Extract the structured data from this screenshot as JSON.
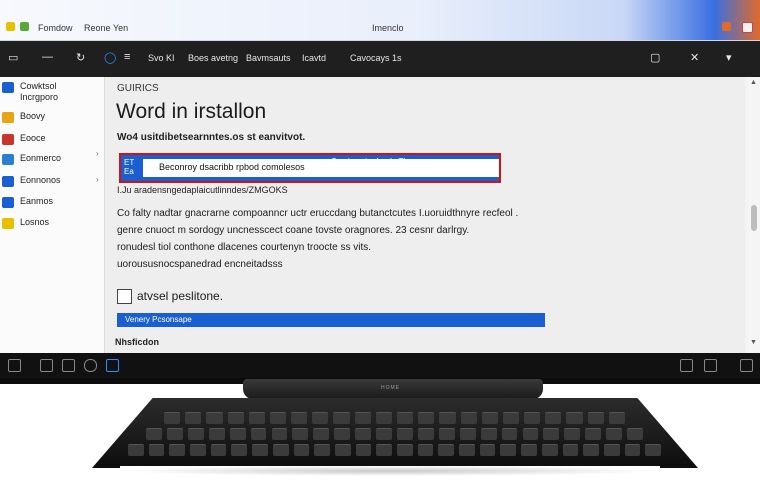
{
  "window": {
    "top_tabs": [
      "Fomdow",
      "Reone",
      "Yen"
    ],
    "title": "Imenclo",
    "accent_colors": {
      "blue": "#1a5fd1",
      "red_highlight": "#d01414",
      "orange": "#e06a2a"
    }
  },
  "toolbar": {
    "items": [
      "Svo KI",
      "Boes avetng",
      "Bavmsauts",
      "Icavtd",
      "Cavocays 1s"
    ],
    "icons": [
      "back-icon",
      "refresh-icon",
      "edge-icon",
      "window-icon",
      "close-icon",
      "chevron-icon"
    ]
  },
  "sidebar": {
    "items": [
      {
        "label": "Cowktsol",
        "sublabel": "Incrgporo",
        "icon_color": "#1a5fd1",
        "icon": "folder-icon"
      },
      {
        "label": "Boovy",
        "icon_color": "#e8a317",
        "icon": "star-icon"
      },
      {
        "label": "Eooce",
        "icon_color": "#c9352b",
        "icon": "document-icon"
      },
      {
        "label": "Eonmerco",
        "icon_color": "#2a7fd4",
        "icon": "grid-icon"
      },
      {
        "label": "Eonnonos",
        "icon_color": "#1a5fd1",
        "icon": "monitor-icon"
      },
      {
        "label": "Eanmos",
        "icon_color": "#1a5fd1",
        "icon": "cloud-icon"
      },
      {
        "label": "Losnos",
        "icon_color": "#e8c000",
        "icon": "bolt-icon"
      }
    ]
  },
  "main": {
    "breadcrumb": "GUIRICS",
    "heading": "Word in irstallon",
    "subheading": "Wo4 usitdibetsearnntes.os st eanvitvot.",
    "banner": {
      "text": "Beconroy dsacribb rpbod comolesos",
      "right_text": "Cemiuncriwchenlo  Tlcosa",
      "badge": "ET Ea"
    },
    "path_line": "I.Ju aradensngedaplaicutlinndes/ZMGOKS",
    "paragraph": [
      "Co falty nadtar gnacrarne compoanncr uctr eruccdang butanctcutes I.uoruidthnyre recfeol .",
      "genre cnuoct m sordogy uncnesscect coane tovste oragnores. 23 cesnr darlrgy.",
      "ronudesl tiol conthone dlacenes courtenyn troocte ss vits.",
      "uoroususnocspanedrad encneitadsss"
    ],
    "checkbox_label": "atvsel peslitone.",
    "progress_label": "Venery Pcsonsape",
    "progress_value": 1.0,
    "footer_label": "Nhsficdon"
  },
  "stand": {
    "brand": "HOME"
  }
}
